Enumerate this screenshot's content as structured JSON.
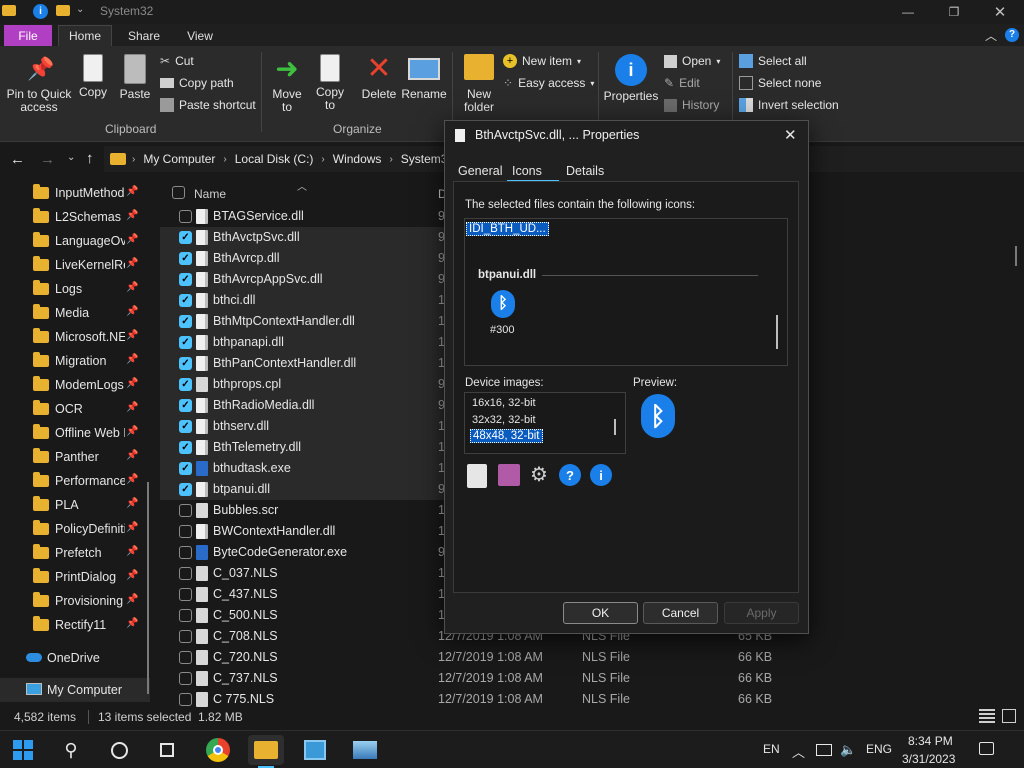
{
  "window": {
    "title": "System32",
    "tabs": {
      "file": "File",
      "home": "Home",
      "share": "Share",
      "view": "View"
    }
  },
  "ribbon": {
    "clipboard": {
      "pin": "Pin to Quick access",
      "copy": "Copy",
      "paste": "Paste",
      "cut": "Cut",
      "copy_path": "Copy path",
      "paste_shortcut": "Paste shortcut",
      "group": "Clipboard"
    },
    "organize": {
      "move_to": "Move to",
      "copy_to": "Copy to",
      "delete": "Delete",
      "rename": "Rename",
      "group": "Organize"
    },
    "new": {
      "new_folder": "New folder",
      "new_item": "New item",
      "easy_access": "Easy access"
    },
    "open": {
      "properties": "Properties",
      "open": "Open",
      "edit": "Edit",
      "history": "History"
    },
    "select": {
      "select_all": "Select all",
      "select_none": "Select none",
      "invert": "Invert selection"
    }
  },
  "address": {
    "crumbs": [
      "My Computer",
      "Local Disk (C:)",
      "Windows",
      "System32"
    ]
  },
  "nav": {
    "items": [
      {
        "label": "InputMethod"
      },
      {
        "label": "L2Schemas"
      },
      {
        "label": "LanguageOverlayCache"
      },
      {
        "label": "LiveKernelReports"
      },
      {
        "label": "Logs"
      },
      {
        "label": "Media"
      },
      {
        "label": "Microsoft.NET"
      },
      {
        "label": "Migration"
      },
      {
        "label": "ModemLogs"
      },
      {
        "label": "OCR"
      },
      {
        "label": "Offline Web Pages"
      },
      {
        "label": "Panther"
      },
      {
        "label": "Performance"
      },
      {
        "label": "PLA"
      },
      {
        "label": "PolicyDefinitions"
      },
      {
        "label": "Prefetch"
      },
      {
        "label": "PrintDialog"
      },
      {
        "label": "Provisioning"
      },
      {
        "label": "Rectify11"
      }
    ],
    "onedrive": "OneDrive",
    "mycomputer": "My Computer"
  },
  "list": {
    "header": {
      "name": "Name",
      "date": "D"
    },
    "rows": [
      {
        "name": "BTAGService.dll",
        "checked": false,
        "date": "9",
        "type": "",
        "size": ""
      },
      {
        "name": "BthAvctpSvc.dll",
        "checked": true,
        "date": "9",
        "type": "",
        "size": ""
      },
      {
        "name": "BthAvrcp.dll",
        "checked": true,
        "date": "9",
        "type": "",
        "size": ""
      },
      {
        "name": "BthAvrcpAppSvc.dll",
        "checked": true,
        "date": "9",
        "type": "",
        "size": ""
      },
      {
        "name": "bthci.dll",
        "checked": true,
        "date": "1",
        "type": "",
        "size": ""
      },
      {
        "name": "BthMtpContextHandler.dll",
        "checked": true,
        "date": "1",
        "type": "",
        "size": ""
      },
      {
        "name": "bthpanapi.dll",
        "checked": true,
        "date": "1",
        "type": "",
        "size": ""
      },
      {
        "name": "BthPanContextHandler.dll",
        "checked": true,
        "date": "1",
        "type": "",
        "size": ""
      },
      {
        "name": "bthprops.cpl",
        "checked": true,
        "date": "9",
        "type": "",
        "size": ""
      },
      {
        "name": "BthRadioMedia.dll",
        "checked": true,
        "date": "9",
        "type": "",
        "size": ""
      },
      {
        "name": "bthserv.dll",
        "checked": true,
        "date": "1",
        "type": "",
        "size": ""
      },
      {
        "name": "BthTelemetry.dll",
        "checked": true,
        "date": "1",
        "type": "",
        "size": ""
      },
      {
        "name": "bthudtask.exe",
        "checked": true,
        "date": "1",
        "type": "",
        "size": ""
      },
      {
        "name": "btpanui.dll",
        "checked": true,
        "date": "9",
        "type": "",
        "size": ""
      },
      {
        "name": "Bubbles.scr",
        "checked": false,
        "date": "1",
        "type": "",
        "size": ""
      },
      {
        "name": "BWContextHandler.dll",
        "checked": false,
        "date": "1",
        "type": "",
        "size": ""
      },
      {
        "name": "ByteCodeGenerator.exe",
        "checked": false,
        "date": "9",
        "type": "",
        "size": ""
      },
      {
        "name": "C_037.NLS",
        "checked": false,
        "date": "1",
        "type": "",
        "size": ""
      },
      {
        "name": "C_437.NLS",
        "checked": false,
        "date": "1",
        "type": "",
        "size": ""
      },
      {
        "name": "C_500.NLS",
        "checked": false,
        "date": "1",
        "type": "",
        "size": ""
      },
      {
        "name": "C_708.NLS",
        "checked": false,
        "date": "12/7/2019 1:08 AM",
        "type": "NLS File",
        "size": "65 KB"
      },
      {
        "name": "C_720.NLS",
        "checked": false,
        "date": "12/7/2019 1:08 AM",
        "type": "NLS File",
        "size": "66 KB"
      },
      {
        "name": "C_737.NLS",
        "checked": false,
        "date": "12/7/2019 1:08 AM",
        "type": "NLS File",
        "size": "66 KB"
      },
      {
        "name": "C 775.NLS",
        "checked": false,
        "date": "12/7/2019 1:08 AM",
        "type": "NLS File",
        "size": "66 KB"
      }
    ]
  },
  "status": {
    "items": "4,582 items",
    "selected": "13 items selected  1.82 MB"
  },
  "dialog": {
    "title": "BthAvctpSvc.dll, ... Properties",
    "tabs": [
      "General",
      "Icons",
      "Details"
    ],
    "intro": "The selected files contain the following icons:",
    "selected_icon": "IDI_BTH_UD...",
    "group_label": "btpanui.dll",
    "icon_id": "#300",
    "device_images_label": "Device images:",
    "device_images": [
      "16x16, 32-bit",
      "32x32, 32-bit",
      "48x48, 32-bit"
    ],
    "preview_label": "Preview:",
    "ok": "OK",
    "cancel": "Cancel",
    "apply": "Apply"
  },
  "taskbar": {
    "lang": "EN",
    "ime": "ENG",
    "time": "8:34 PM",
    "date": "3/31/2023"
  }
}
